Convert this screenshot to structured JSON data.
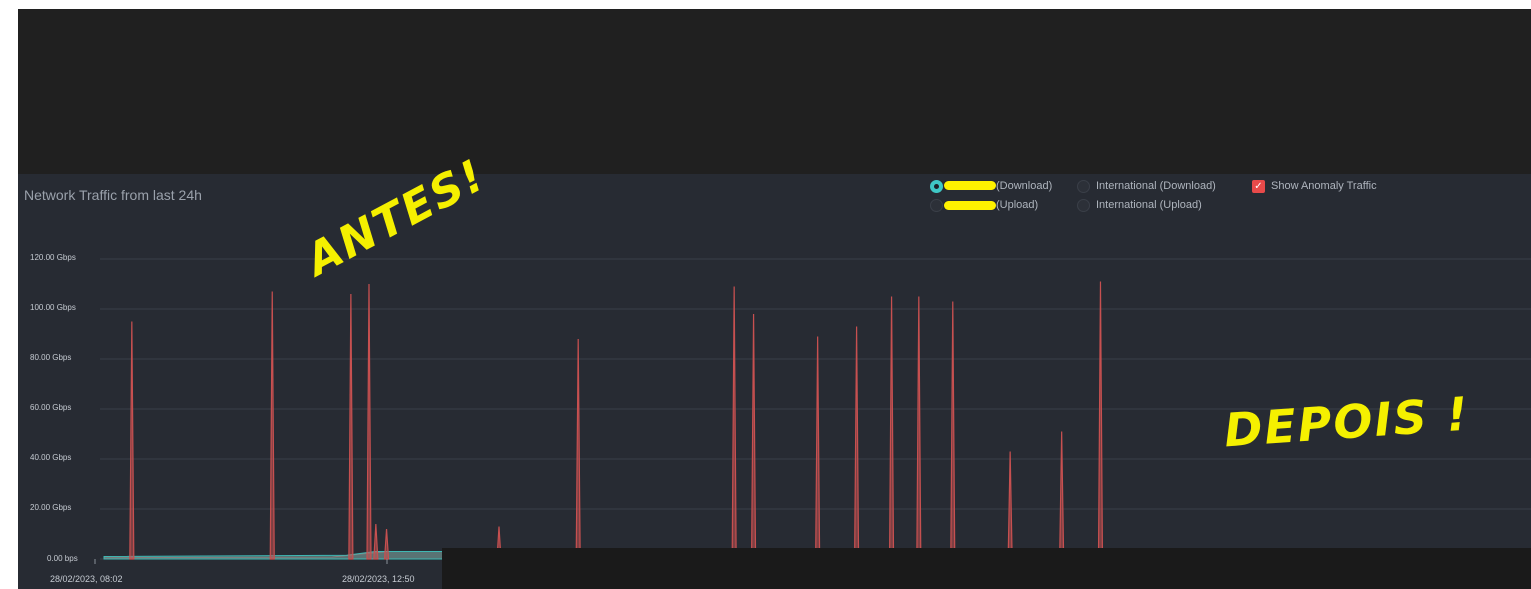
{
  "chart_data": {
    "type": "area",
    "title": "Network Traffic from last 24h",
    "y_unit": "Gbps",
    "ylim": [
      0,
      120
    ],
    "yticks": [
      0,
      20,
      40,
      60,
      80,
      100,
      120
    ],
    "ytick_labels": [
      "0.00 bps",
      "20.00 Gbps",
      "40.00 Gbps",
      "60.00 Gbps",
      "80.00 Gbps",
      "100.00 Gbps",
      "120.00 Gbps"
    ],
    "xtick_labels": [
      "28/02/2023, 08:02",
      "28/02/2023, 12:50"
    ],
    "grid": true,
    "series": [
      {
        "name": "Anomaly Traffic",
        "color": "#c75050",
        "spikes": [
          {
            "t": 0.0195,
            "v": 95
          },
          {
            "t": 0.1179,
            "v": 107
          },
          {
            "t": 0.173,
            "v": 106
          },
          {
            "t": 0.1857,
            "v": 110
          },
          {
            "t": 0.1905,
            "v": 14
          },
          {
            "t": 0.198,
            "v": 12
          },
          {
            "t": 0.2768,
            "v": 13
          },
          {
            "t": 0.3323,
            "v": 88
          },
          {
            "t": 0.4416,
            "v": 109
          },
          {
            "t": 0.4552,
            "v": 98
          },
          {
            "t": 0.5001,
            "v": 89
          },
          {
            "t": 0.5274,
            "v": 93
          },
          {
            "t": 0.5519,
            "v": 105
          },
          {
            "t": 0.571,
            "v": 105
          },
          {
            "t": 0.5948,
            "v": 103
          },
          {
            "t": 0.635,
            "v": 43
          },
          {
            "t": 0.6711,
            "v": 51
          },
          {
            "t": 0.6983,
            "v": 111
          }
        ],
        "baseline": [
          {
            "t": 0.0,
            "v": 0.5
          },
          {
            "t": 0.16,
            "v": 0.8
          },
          {
            "t": 0.18,
            "v": 2
          },
          {
            "t": 0.2,
            "v": 3
          },
          {
            "t": 0.28,
            "v": 3
          },
          {
            "t": 0.5,
            "v": 1
          },
          {
            "t": 0.52,
            "v": 3
          },
          {
            "t": 0.64,
            "v": 3
          },
          {
            "t": 0.66,
            "v": 1
          },
          {
            "t": 1.0,
            "v": 1
          }
        ]
      },
      {
        "name": "(Download)",
        "color": "#3fb8b4",
        "baseline": [
          {
            "t": 0.0,
            "v": 1
          },
          {
            "t": 0.17,
            "v": 1.5
          },
          {
            "t": 0.19,
            "v": 3
          },
          {
            "t": 0.28,
            "v": 3
          },
          {
            "t": 0.5,
            "v": 1.5
          },
          {
            "t": 0.52,
            "v": 3
          },
          {
            "t": 0.66,
            "v": 3
          },
          {
            "t": 0.68,
            "v": 1
          },
          {
            "t": 1.0,
            "v": 1
          }
        ]
      }
    ]
  },
  "legend": {
    "download": "(Download)",
    "upload": "(Upload)",
    "intl_download": "International (Download)",
    "intl_upload": "International (Upload)",
    "anomaly": "Show Anomaly Traffic",
    "anomaly_checked": true,
    "selected": "download"
  },
  "annotations": {
    "antes": "ANTES!",
    "depois": "DEPOIS !"
  },
  "colors": {
    "panel": "#272b33",
    "grid": "#3a3f48",
    "anomaly": "#c75050",
    "download": "#3fb8b4",
    "annotation": "#f5f000"
  }
}
